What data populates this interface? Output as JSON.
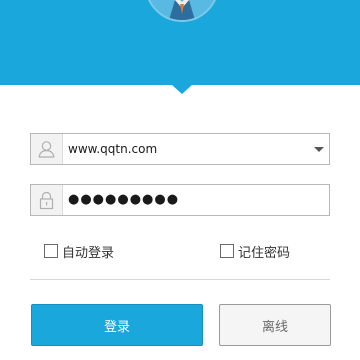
{
  "colors": {
    "accent": "#1aa7dc",
    "field_border": "#b8b8b8",
    "offline_button_bg": "#f5f5f5"
  },
  "header": {
    "avatar_icon": "user-avatar-illustration"
  },
  "username": {
    "icon": "user-icon",
    "value": "www.qqtn.com",
    "dropdown_icon": "chevron-down-icon"
  },
  "password": {
    "icon": "lock-icon",
    "masked_value": "●●●●●●●●●"
  },
  "options": {
    "auto_login_label": "自动登录",
    "remember_password_label": "记住密码"
  },
  "buttons": {
    "login_label": "登录",
    "offline_label": "离线"
  }
}
